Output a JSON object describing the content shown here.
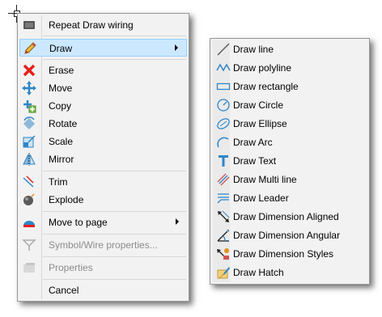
{
  "main_menu": {
    "items": [
      {
        "label": "Repeat Draw wiring",
        "icon": "repeat-icon"
      },
      {
        "label": "Draw",
        "icon": "pencil-icon",
        "has_submenu": true,
        "selected": true
      },
      {
        "label": "Erase",
        "icon": "erase-x-icon"
      },
      {
        "label": "Move",
        "icon": "move-arrows-icon"
      },
      {
        "label": "Copy",
        "icon": "copy-icon"
      },
      {
        "label": "Rotate",
        "icon": "rotate-icon"
      },
      {
        "label": "Scale",
        "icon": "scale-icon"
      },
      {
        "label": "Mirror",
        "icon": "mirror-icon"
      },
      {
        "label": "Trim",
        "icon": "trim-icon"
      },
      {
        "label": "Explode",
        "icon": "explode-icon"
      },
      {
        "label": "Move to page",
        "icon": "move-to-page-icon",
        "has_submenu": true
      },
      {
        "label": "Symbol/Wire properties...",
        "icon": "symbol-properties-icon",
        "disabled": true
      },
      {
        "label": "Properties",
        "icon": "properties-icon",
        "disabled": true
      },
      {
        "label": "Cancel",
        "icon": ""
      }
    ]
  },
  "draw_submenu": {
    "items": [
      {
        "label": "Draw line",
        "icon": "line-icon"
      },
      {
        "label": "Draw polyline",
        "icon": "polyline-icon"
      },
      {
        "label": "Draw rectangle",
        "icon": "rectangle-icon"
      },
      {
        "label": "Draw Circle",
        "icon": "circle-icon"
      },
      {
        "label": "Draw Ellipse",
        "icon": "ellipse-icon"
      },
      {
        "label": "Draw Arc",
        "icon": "arc-icon"
      },
      {
        "label": "Draw Text",
        "icon": "text-icon"
      },
      {
        "label": "Draw Multi line",
        "icon": "multi-line-icon"
      },
      {
        "label": "Draw Leader",
        "icon": "leader-icon"
      },
      {
        "label": "Draw Dimension Aligned",
        "icon": "dimension-aligned-icon"
      },
      {
        "label": "Draw Dimension Angular",
        "icon": "dimension-angular-icon"
      },
      {
        "label": "Draw Dimension Styles",
        "icon": "dimension-styles-icon"
      },
      {
        "label": "Draw Hatch",
        "icon": "hatch-icon"
      }
    ]
  },
  "colors": {
    "menu_background": "#f2f2f2",
    "selection_background": "#cce8ff",
    "selection_border": "#99d1ff",
    "icon_blue": "#2f86c8",
    "erase_red": "#e8201c"
  }
}
